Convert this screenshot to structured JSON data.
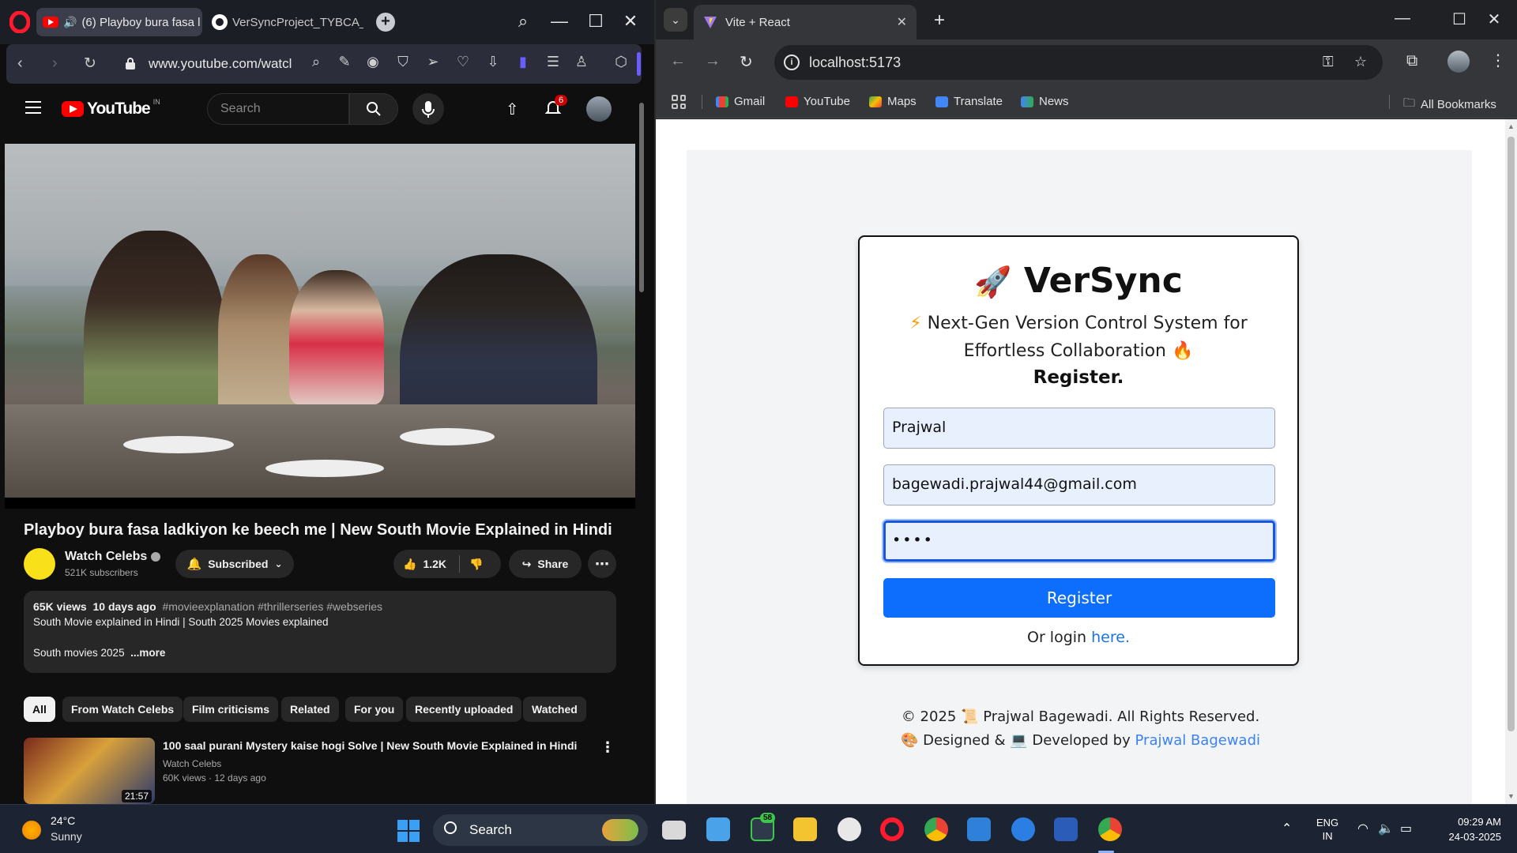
{
  "opera": {
    "tabs": [
      {
        "title": "(6) Playboy bura fasa l"
      },
      {
        "title": "VerSyncProject_TYBCA_SE"
      }
    ],
    "url": "www.youtube.com/watcl"
  },
  "youtube": {
    "logo_text": "YouTube",
    "region": "IN",
    "search_placeholder": "Search",
    "notification_count": "6",
    "video_title": "Playboy bura fasa ladkiyon ke beech me | New South Movie Explained in Hindi",
    "channel_name": "Watch Celebs",
    "subscribers": "521K subscribers",
    "subscribed_label": "Subscribed",
    "likes": "1.2K",
    "share_label": "Share",
    "description": {
      "views": "65K views",
      "date": "10 days ago",
      "tags": "#movieexplanation #thrillerseries #webseries",
      "line1": "South Movie explained in Hindi | South 2025 Movies explained",
      "line2": "South movies 2025",
      "more": "...more"
    },
    "chips": [
      "All",
      "From Watch Celebs",
      "Film criticisms",
      "Related",
      "For you",
      "Recently uploaded",
      "Watched"
    ],
    "recommendation": {
      "title": "100 saal purani Mystery kaise hogi Solve | New South Movie Explained in Hindi",
      "channel": "Watch Celebs",
      "meta": "60K views · 12 days ago",
      "duration": "21:57"
    }
  },
  "chrome": {
    "tab_title": "Vite + React",
    "url": "localhost:5173",
    "bookmarks": [
      "Gmail",
      "YouTube",
      "Maps",
      "Translate",
      "News"
    ],
    "all_bookmarks": "All Bookmarks"
  },
  "app": {
    "brand": "VerSync",
    "tagline_1": "Next-Gen Version Control System for",
    "tagline_2": "Effortless Collaboration",
    "heading": "Register.",
    "username_value": "Prajwal",
    "email_value": "bagewadi.prajwal44@gmail.com",
    "password_value": "••••",
    "register_button": "Register",
    "login_prefix": "Or login",
    "login_link": "here.",
    "footer_line1": "© 2025 📜 Prajwal Bagewadi. All Rights Reserved.",
    "footer_designed": "🎨 Designed & 💻 Developed by",
    "footer_author": "Prajwal Bagewadi"
  },
  "taskbar": {
    "temperature": "24°C",
    "condition": "Sunny",
    "search_label": "Search",
    "badge_count": "58",
    "lang_1": "ENG",
    "lang_2": "IN",
    "time": "09:29 AM",
    "date": "24-03-2025"
  },
  "colors": {
    "register_blue": "#0d6efd",
    "link_blue": "#1a73e8",
    "youtube_red": "#ff0000"
  }
}
